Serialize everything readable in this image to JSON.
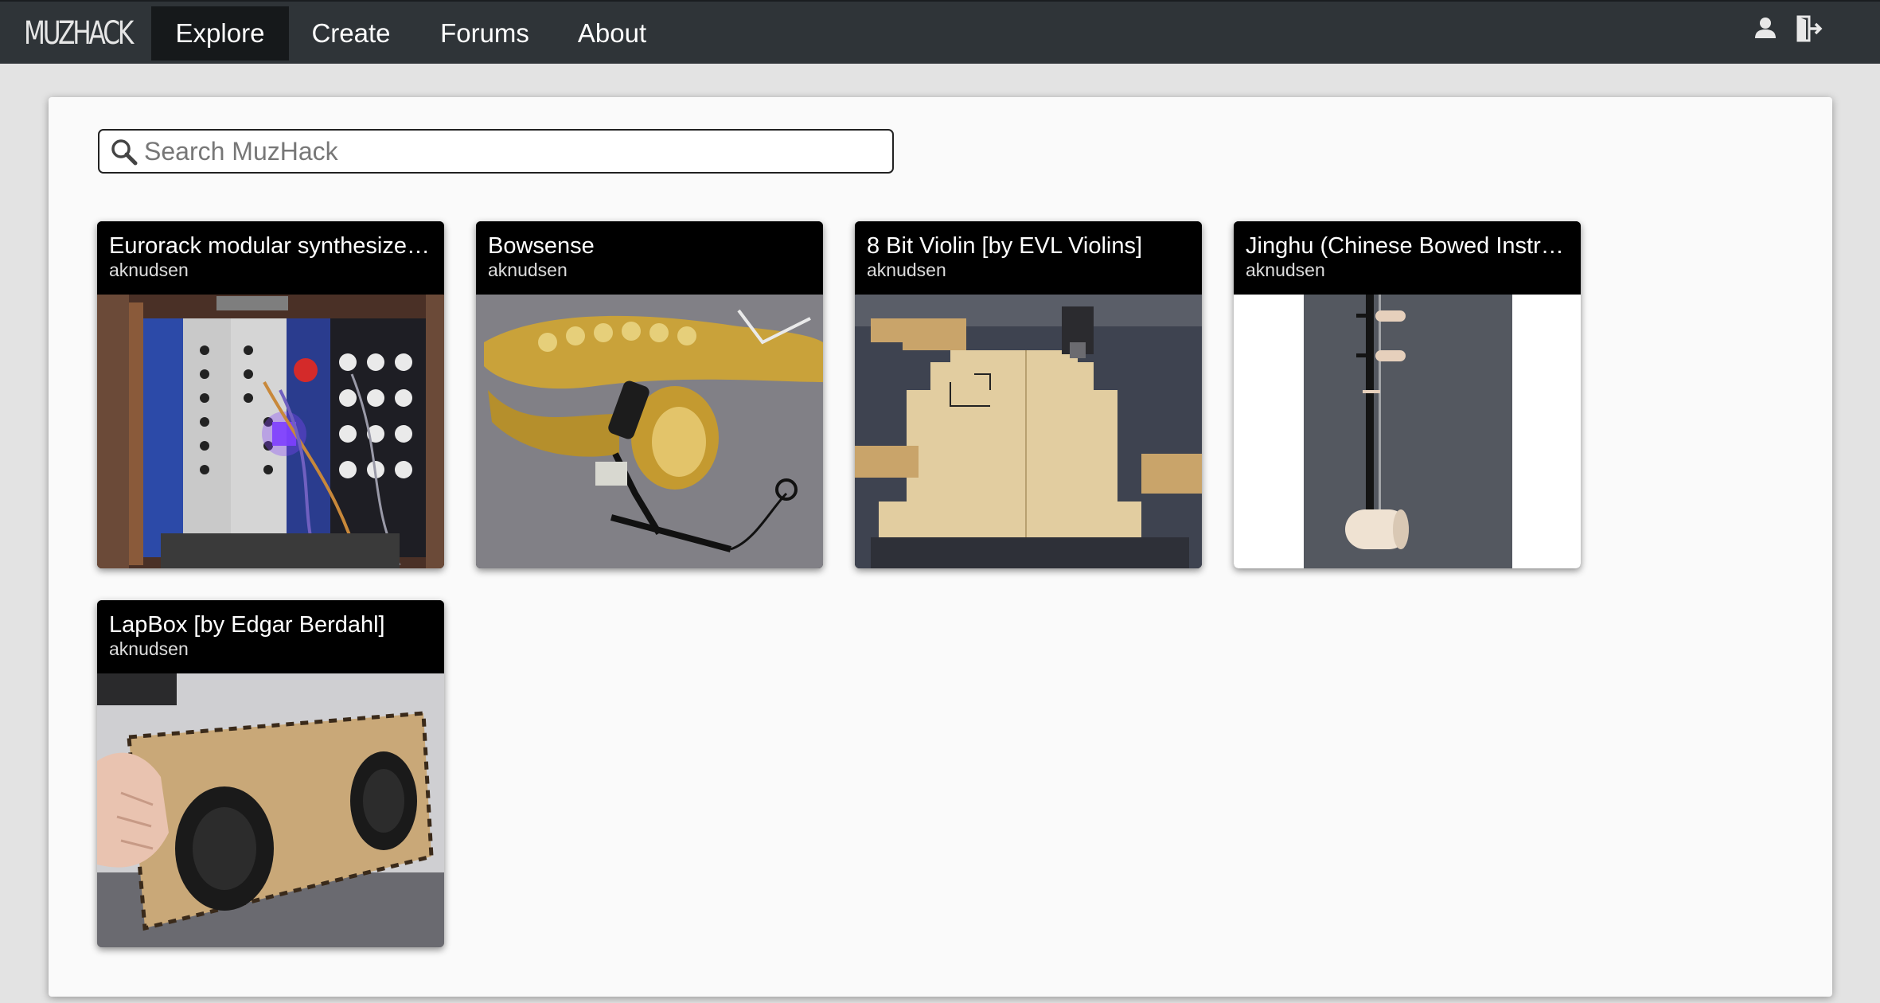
{
  "brand": {
    "logo_text": "MUZHACK"
  },
  "nav": {
    "items": [
      {
        "label": "Explore",
        "active": true
      },
      {
        "label": "Create",
        "active": false
      },
      {
        "label": "Forums",
        "active": false
      },
      {
        "label": "About",
        "active": false
      }
    ],
    "icons": [
      "user-icon",
      "logout-icon"
    ]
  },
  "search": {
    "placeholder": "Search MuzHack",
    "value": ""
  },
  "projects": [
    {
      "title": "Eurorack modular synthesizer…",
      "author": "aknudsen"
    },
    {
      "title": "Bowsense",
      "author": "aknudsen"
    },
    {
      "title": "8 Bit Violin [by EVL Violins]",
      "author": "aknudsen"
    },
    {
      "title": "Jinghu (Chinese Bowed Instru…",
      "author": "aknudsen"
    },
    {
      "title": "LapBox [by Edgar Berdahl]",
      "author": "aknudsen"
    }
  ],
  "colors": {
    "navbar": "#2f3438",
    "nav_active": "#16191b",
    "card_header": "#000000"
  }
}
